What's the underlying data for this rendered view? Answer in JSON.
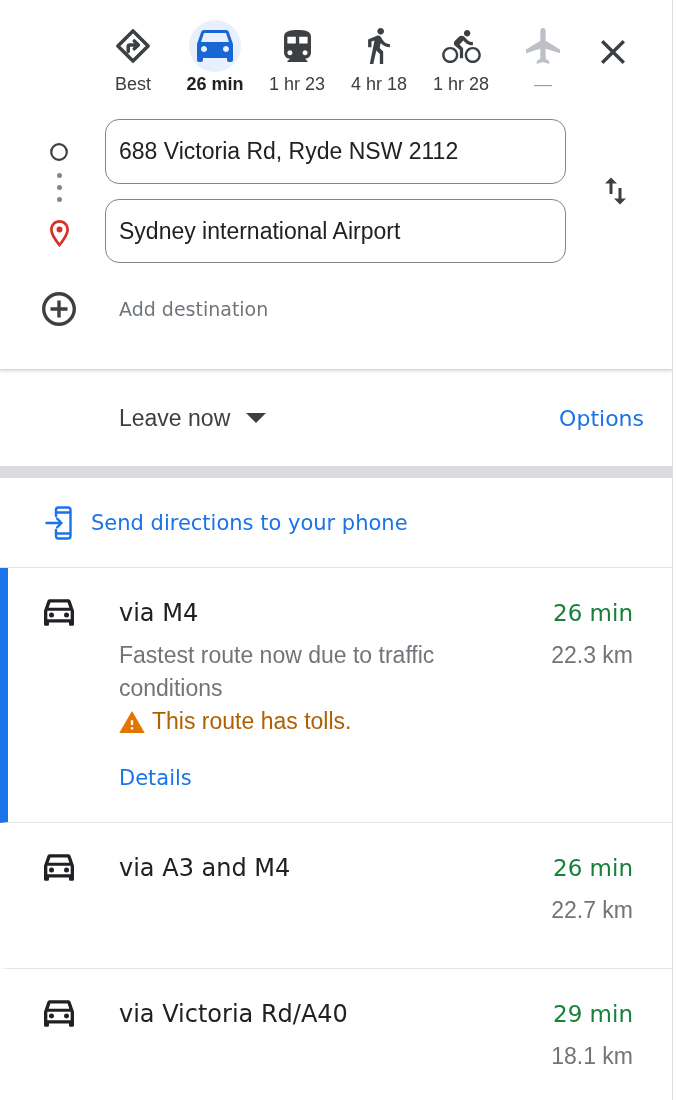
{
  "travel_modes": [
    {
      "kind": "best",
      "label": "Best",
      "selected": false,
      "disabled": false
    },
    {
      "kind": "drive",
      "label": "26 min",
      "selected": true,
      "disabled": false
    },
    {
      "kind": "transit",
      "label": "1 hr 23",
      "selected": false,
      "disabled": false
    },
    {
      "kind": "walk",
      "label": "4 hr 18",
      "selected": false,
      "disabled": false
    },
    {
      "kind": "bike",
      "label": "1 hr 28",
      "selected": false,
      "disabled": false
    },
    {
      "kind": "flight",
      "label": "—",
      "selected": false,
      "disabled": true
    }
  ],
  "directions_form": {
    "origin": {
      "value": "688 Victoria Rd, Ryde NSW 2112"
    },
    "destination": {
      "value": "Sydney international Airport"
    },
    "add_destination": "Add destination"
  },
  "departure": {
    "label": "Leave now",
    "options_link": "Options"
  },
  "send_to_phone": "Send directions to your phone",
  "routes": [
    {
      "name": "via M4",
      "duration": "26 min",
      "distance": "22.3 km",
      "selected": true,
      "description": "Fastest route now due to traffic conditions",
      "warning": "This route has tolls.",
      "details_link": "Details"
    },
    {
      "name": "via A3 and M4",
      "duration": "26 min",
      "distance": "22.7 km",
      "selected": false
    },
    {
      "name": "via Victoria Rd/A40",
      "duration": "29 min",
      "distance": "18.1 km",
      "selected": false
    }
  ]
}
